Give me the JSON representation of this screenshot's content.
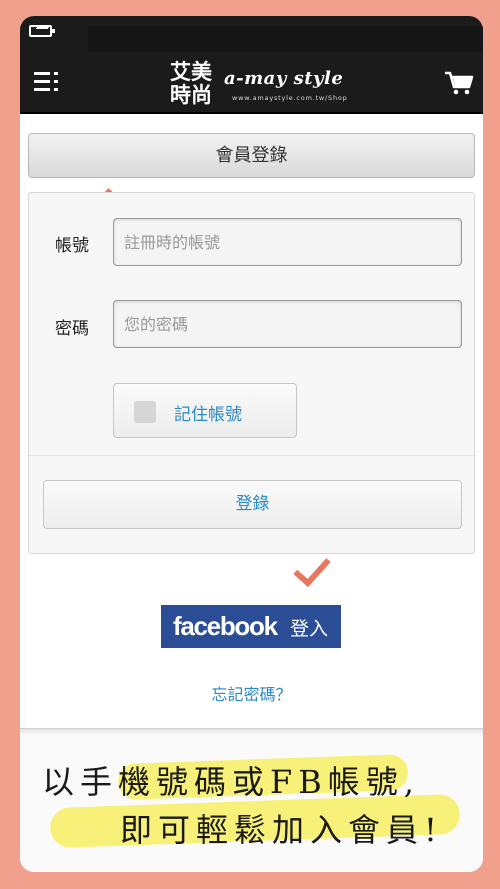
{
  "header": {
    "logo_cn": "艾美時尚",
    "logo_en": "a-may style",
    "logo_url": "www.amaystyle.com.tw/Shop",
    "menu_icon": "menu-icon",
    "cart_icon": "cart-icon"
  },
  "page": {
    "title": "會員登錄"
  },
  "form": {
    "account_label": "帳號",
    "account_placeholder": "註冊時的帳號",
    "password_label": "密碼",
    "password_placeholder": "您的密碼",
    "remember_label": "記住帳號",
    "login_label": "登錄"
  },
  "facebook": {
    "brand": "facebook",
    "suffix": "登入"
  },
  "forgot_label": "忘記密碼？",
  "caption": {
    "line1": "以手機號碼或FB帳號,",
    "line2": "即可輕鬆加入會員!"
  },
  "colors": {
    "background": "#f0a08c",
    "accent_blue": "#2a8ac4",
    "facebook_blue": "#2b4d96",
    "checkmark": "#e9765e",
    "highlight": "#f7ef6a"
  }
}
